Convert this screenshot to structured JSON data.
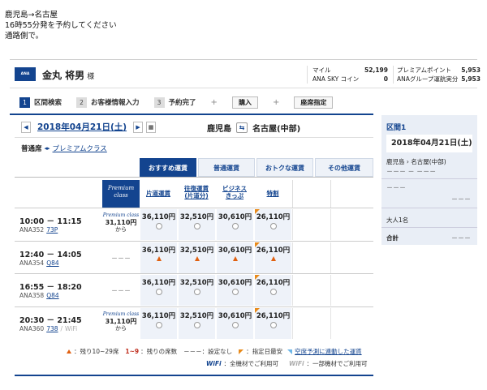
{
  "instruction": [
    "鹿児島→名古屋",
    "16時55分発を予約してください",
    "通路側で。"
  ],
  "header": {
    "logo": "ANA CARD",
    "user_name": "金丸 将男",
    "sama": "様",
    "miles_label": "マイル",
    "miles_value": "52,199",
    "sky_coin_label": "ANA SKY コイン",
    "sky_coin_value": "0",
    "premium_points_label": "プレミアムポイント",
    "premium_points_value": "5,953",
    "group_label": "ANAグループ運航実分",
    "group_value": "5,953"
  },
  "steps": [
    {
      "num": "1",
      "label": "区間検索",
      "active": true
    },
    {
      "num": "2",
      "label": "お客様情報入力",
      "active": false
    },
    {
      "num": "3",
      "label": "予約完了",
      "active": false
    }
  ],
  "step_buttons": [
    "購入",
    "座席指定"
  ],
  "search": {
    "prev": "◀",
    "next": "▶",
    "date": "2018年04月21日(土)",
    "calendar_icon": "calendar-icon",
    "origin": "鹿児島",
    "destination": "名古屋(中部)",
    "swap": "⇆"
  },
  "cabin": {
    "current": "普通席",
    "arrow": "◂▸",
    "link": "プレミアムクラス"
  },
  "tabs": [
    {
      "label": "おすすめ運賃",
      "active": true
    },
    {
      "label": "普通運賃",
      "active": false
    },
    {
      "label": "おトクな運賃",
      "active": false
    },
    {
      "label": "その他運賃",
      "active": false
    }
  ],
  "fare_headers": {
    "premium": [
      "Premium",
      "class"
    ],
    "katamichi": "片道運賃",
    "ofuku": [
      "往復運賃",
      "(片道分)"
    ],
    "business": [
      "ビジネス",
      "きっぷ"
    ],
    "tokuwari": "特割"
  },
  "flights": [
    {
      "time": "10:00 － 11:15",
      "flight_no": "ANA352",
      "aircraft": "73P",
      "wifi": "",
      "premium": {
        "label": "Premium class",
        "price": "31,110円",
        "suffix": "から"
      },
      "fares": [
        {
          "price": "36,110円",
          "mark": "radio",
          "flag": false
        },
        {
          "price": "32,510円",
          "mark": "radio",
          "flag": false
        },
        {
          "price": "30,610円",
          "mark": "radio",
          "flag": false
        },
        {
          "price": "26,110円",
          "mark": "radio",
          "flag": true
        }
      ]
    },
    {
      "time": "12:40 － 14:05",
      "flight_no": "ANA354",
      "aircraft": "Q84",
      "wifi": "",
      "premium": {
        "dash": "－－－"
      },
      "fares": [
        {
          "price": "36,110円",
          "mark": "tri",
          "flag": false
        },
        {
          "price": "32,510円",
          "mark": "tri",
          "flag": false
        },
        {
          "price": "30,610円",
          "mark": "tri",
          "flag": false
        },
        {
          "price": "26,110円",
          "mark": "tri",
          "flag": true
        }
      ]
    },
    {
      "time": "16:55 － 18:20",
      "flight_no": "ANA358",
      "aircraft": "Q84",
      "wifi": "",
      "premium": {
        "dash": "－－－"
      },
      "fares": [
        {
          "price": "36,110円",
          "mark": "radio",
          "flag": false
        },
        {
          "price": "32,510円",
          "mark": "radio",
          "flag": false
        },
        {
          "price": "30,610円",
          "mark": "radio",
          "flag": false
        },
        {
          "price": "26,110円",
          "mark": "radio",
          "flag": true
        }
      ]
    },
    {
      "time": "20:30 － 21:45",
      "flight_no": "ANA360",
      "aircraft": "738",
      "wifi": "WiFi",
      "premium": {
        "label": "Premium class",
        "price": "31,110円",
        "suffix": "から"
      },
      "fares": [
        {
          "price": "36,110円",
          "mark": "radio",
          "flag": false
        },
        {
          "price": "32,510円",
          "mark": "radio",
          "flag": false
        },
        {
          "price": "30,610円",
          "mark": "radio",
          "flag": false
        },
        {
          "price": "26,110円",
          "mark": "radio",
          "flag": true
        }
      ]
    }
  ],
  "legend": {
    "tri_text": "：残り10~29席",
    "num_mark": "1~9",
    "num_text": "：残りの席数",
    "dash_mark": "－－－",
    "dash_text": "：設定なし",
    "flag_text": "：指定日最安",
    "link_text": "空席予測に連動した運賃",
    "wifi_all_mark": "WiFi",
    "wifi_all_text": "：全機材でご利用可",
    "wifi_part_mark": "WiFi",
    "wifi_part_text": "：一部機材でご利用可"
  },
  "summary": {
    "title": "区間1",
    "date": "2018年04月21日(土)",
    "route": "鹿児島 › 名古屋(中部)",
    "dash1": "－－－ － －－－",
    "dash2": "－－－",
    "dash3": "－－－",
    "pax": "大人1名",
    "total_label": "合計",
    "total_value": "－－－"
  }
}
